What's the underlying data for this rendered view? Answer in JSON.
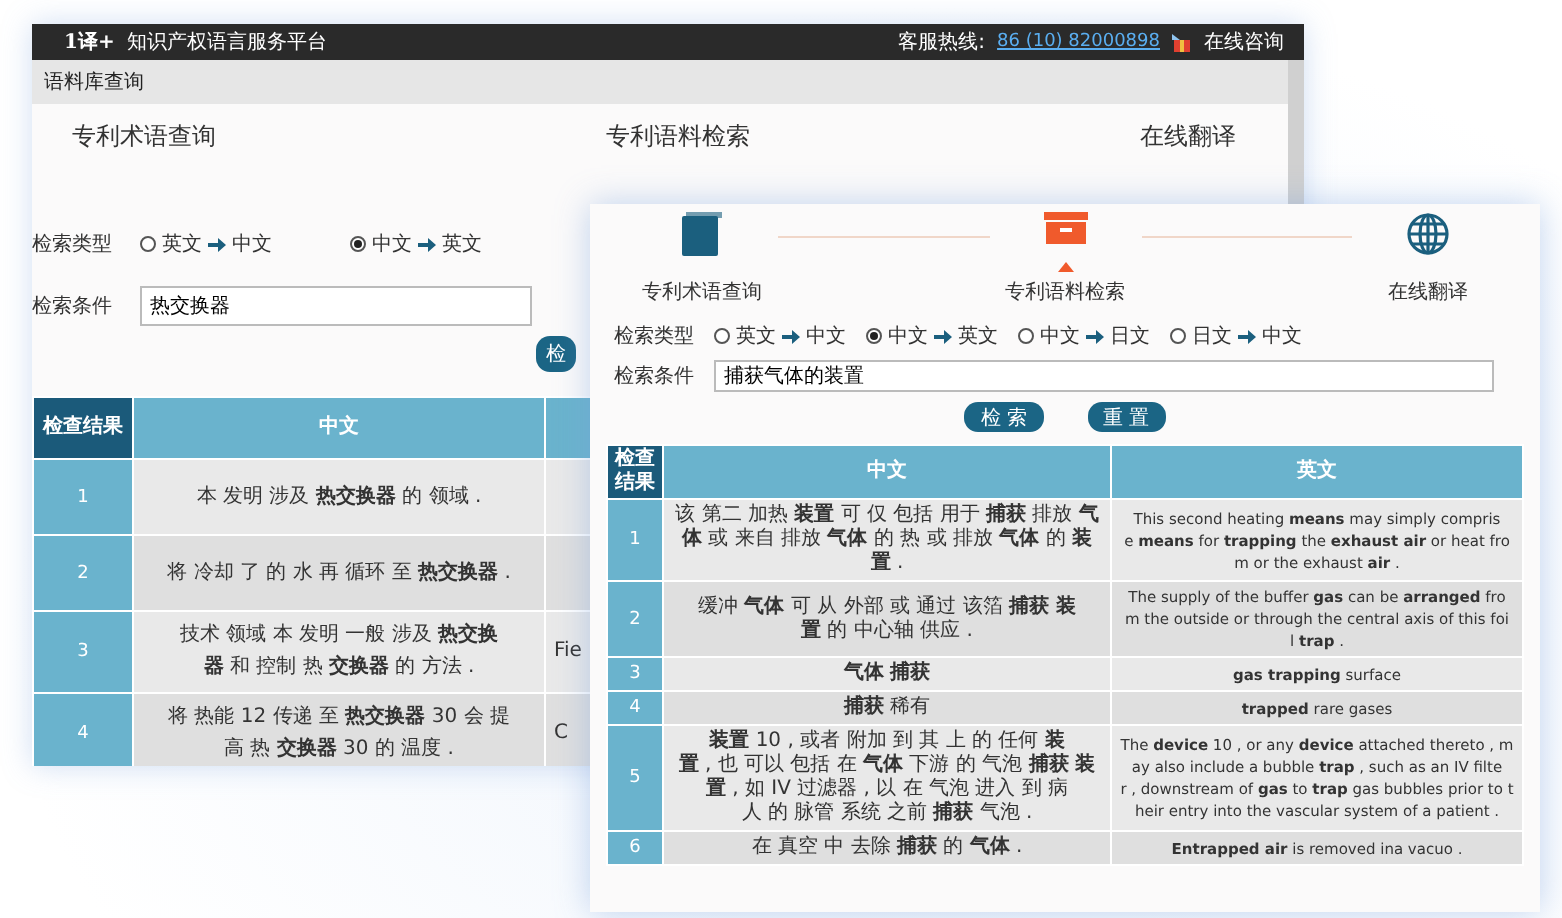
{
  "back_window": {
    "header": {
      "logo": "1译+",
      "platform": "知识产权语言服务平台",
      "hotline_label": "客服热线:",
      "hotline": "86 (10) 82000898",
      "consult": "在线咨询"
    },
    "menu_title": "语料库查询",
    "nav": [
      {
        "label": "专利术语查询"
      },
      {
        "label": "专利语料检索"
      },
      {
        "label": "在线翻译"
      }
    ],
    "search_type_label": "检索类型",
    "directions": [
      {
        "from": "英文",
        "to": "中文",
        "selected": false
      },
      {
        "from": "中文",
        "to": "英文",
        "selected": true
      }
    ],
    "condition_label": "检索条件",
    "query": "热交换器",
    "search_button": "检",
    "table": {
      "columns": [
        "检查结果",
        "中文"
      ],
      "rows": [
        {
          "no": "1",
          "zh": "本 发明 涉及 **热交换器** 的 领域 ."
        },
        {
          "no": "2",
          "zh": "将 冷却 了 的 水 再 循环 至 **热交换器** ."
        },
        {
          "no": "3",
          "zh": "技术 领域 本 发明 一般 涉及 **热交换器** 和 控制 热 **交换器** 的 方法 .",
          "column_3": "Fie"
        },
        {
          "no": "4",
          "zh": "将 热能 12 传递 至 **热交换器** 30 会 提高 热 **交换器** 30 的 温度 .",
          "column_3": "C"
        }
      ]
    }
  },
  "front_window": {
    "tabs": [
      {
        "label": "专利术语查询",
        "selected": false
      },
      {
        "label": "专利语料检索",
        "selected": true
      },
      {
        "label": "在线翻译",
        "selected": false
      }
    ],
    "search_type_label": "检索类型",
    "directions": [
      {
        "from": "英文",
        "to": "中文",
        "selected": false
      },
      {
        "from": "中文",
        "to": "英文",
        "selected": true
      },
      {
        "from": "中文",
        "to": "日文",
        "selected": false
      },
      {
        "from": "日文",
        "to": "中文",
        "selected": false
      }
    ],
    "condition_label": "检索条件",
    "query": "捕获气体的装置",
    "buttons": [
      "检 索",
      "重 置"
    ],
    "table": {
      "columns": [
        "检查结果",
        "中文",
        "英文"
      ],
      "rows": [
        {
          "no": "1",
          "zh": "该 第二 加热 **装置** 可 仅 包括 用于 **捕获** 排放 **气体** 或 来自 排放 **气体** 的 热 或 排放 **气体** 的 **装置** .",
          "en": "This second heating **means** may simply comprise **means** for **trapping** the **exhaust air** or heat from or the exhaust **air** ."
        },
        {
          "no": "2",
          "zh": "缓冲 **气体** 可 从 外部 或 通过 该箔 **捕获 装置** 的 中心轴 供应 .",
          "en": "The supply of the buffer **gas** can be **arranged** from the outside or through the central axis of this foil **trap** ."
        },
        {
          "no": "3",
          "zh": "**气体 捕获**",
          "en": "**gas trapping** surface"
        },
        {
          "no": "4",
          "zh": "**捕获** 稀有",
          "en": "**trapped** rare gases"
        },
        {
          "no": "5",
          "zh": "**装置** 10 , 或者 附加 到 其 上 的 任何 **装置** , 也 可以 包括 在 **气体** 下游 的 气泡 **捕获 装置** , 如 IV 过滤器 , 以 在 气泡 进入 到 病人 的 脉管 系统 之前 **捕获** 气泡 .",
          "en": "The **device** 10 , or any **device** attached thereto , may also include a bubble **trap** , such as an IV filter , downstream of **gas** to **trap** gas bubbles prior to their entry into the vascular system of a patient ."
        },
        {
          "no": "6",
          "zh": "在 真空 中 去除 **捕获** 的 **气体** .",
          "en": "**Entrapped air** is removed ina vacuo ."
        }
      ]
    }
  }
}
